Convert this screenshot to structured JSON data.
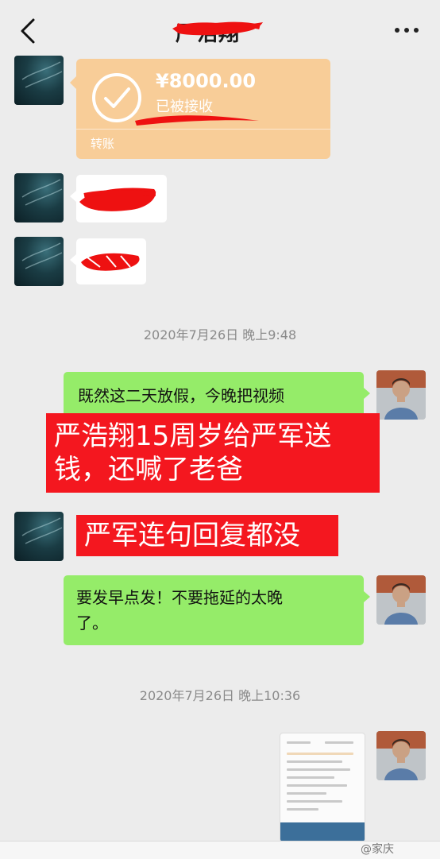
{
  "header": {
    "title": "严浩翔",
    "back_icon": "chevron-left-icon",
    "more_icon": "ellipsis-icon"
  },
  "transfer": {
    "amount": "¥8000.00",
    "status": "已被接收",
    "label": "转账",
    "color": "#f8cd98",
    "icon": "check-circle-icon"
  },
  "timestamps": {
    "first": "2020年7月26日 晚上9:48",
    "second": "2020年7月26日 晚上10:36"
  },
  "messages": {
    "sent_1": "既然这二天放假，今晚把视频",
    "sent_2_line1": "要发早点发！不要拖延的太晚",
    "sent_2_line2": "了。"
  },
  "overlays": {
    "caption_1_line1": "严浩翔15周岁给严军送",
    "caption_1_line2": "钱，还喊了老爸",
    "caption_2": "严军连句回复都没",
    "color": "#f4171f"
  },
  "watermark": "@家庆",
  "colors": {
    "sent_bubble": "#95ec69",
    "received_bubble": "#ffffff",
    "background": "#ececec",
    "redaction": "#ee1111"
  }
}
